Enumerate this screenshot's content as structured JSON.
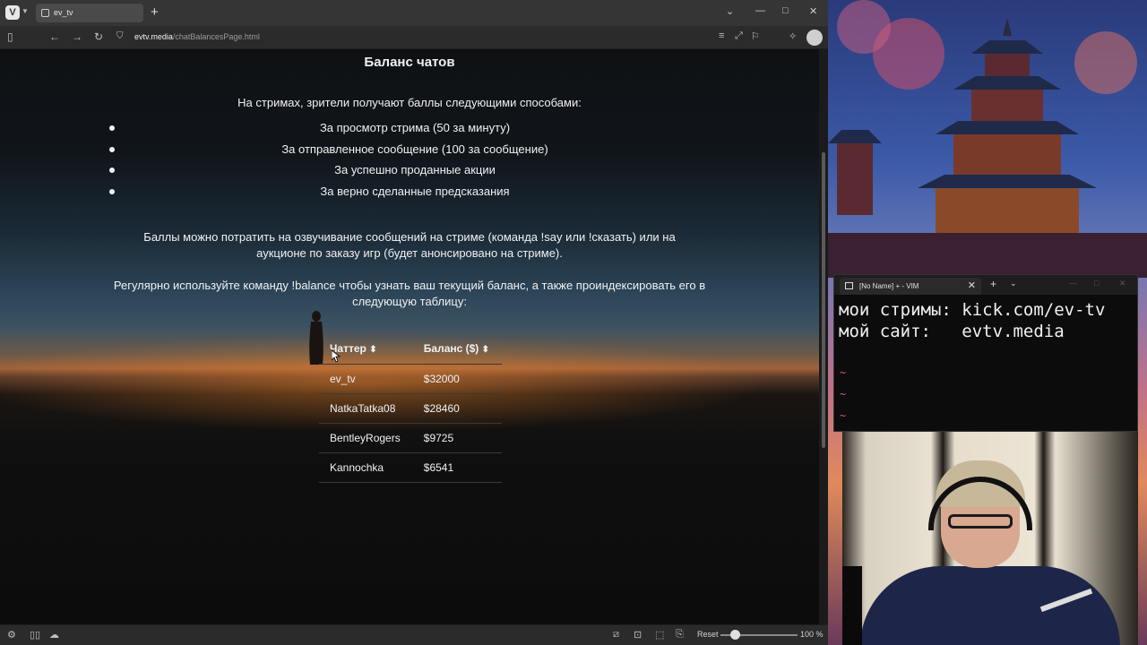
{
  "browser": {
    "tab_title": "ev_tv",
    "url_host": "evtv.media",
    "url_path": "/chatBalancesPage.html",
    "status": {
      "reset_label": "Reset",
      "zoom_value": "100 %",
      "zoom_level": 1.0
    }
  },
  "page": {
    "title": "Баланс чатов",
    "intro": "На стримах, зрители получают баллы следующими способами:",
    "earn_methods": [
      "За просмотр стрима (50 за минуту)",
      "За отправленное сообщение (100 за сообщение)",
      "За успешно проданные акции",
      "За верно сделанные предсказания"
    ],
    "spend_text": "Баллы можно потратить на озвучивание сообщений на стриме (команда !say или !сказать) или на аукционе по заказу игр (будет анонсировано на стриме).",
    "balance_text": "Регулярно используйте команду !balance чтобы узнать ваш текущий баланс, а также проиндексировать его в следующую таблицу:",
    "table": {
      "headers": [
        "Чаттер",
        "Баланс ($)"
      ],
      "sort_icon": "⬍",
      "rows": [
        [
          "ev_tv",
          "$32000"
        ],
        [
          "NatkaTatka08",
          "$28460"
        ],
        [
          "BentleyRogers",
          "$9725"
        ],
        [
          "Kannochka",
          "$6541"
        ]
      ]
    }
  },
  "vim": {
    "tab_title": "[No Name] + - VIM",
    "lines": [
      "мои стримы: kick.com/ev-tv",
      "мой сайт:   evtv.media"
    ],
    "tilde": "~"
  },
  "colors": {
    "page_text": "#f1f1f1",
    "vim_tilde": "#e0508a",
    "browser_chrome": "#2b2b2b"
  }
}
